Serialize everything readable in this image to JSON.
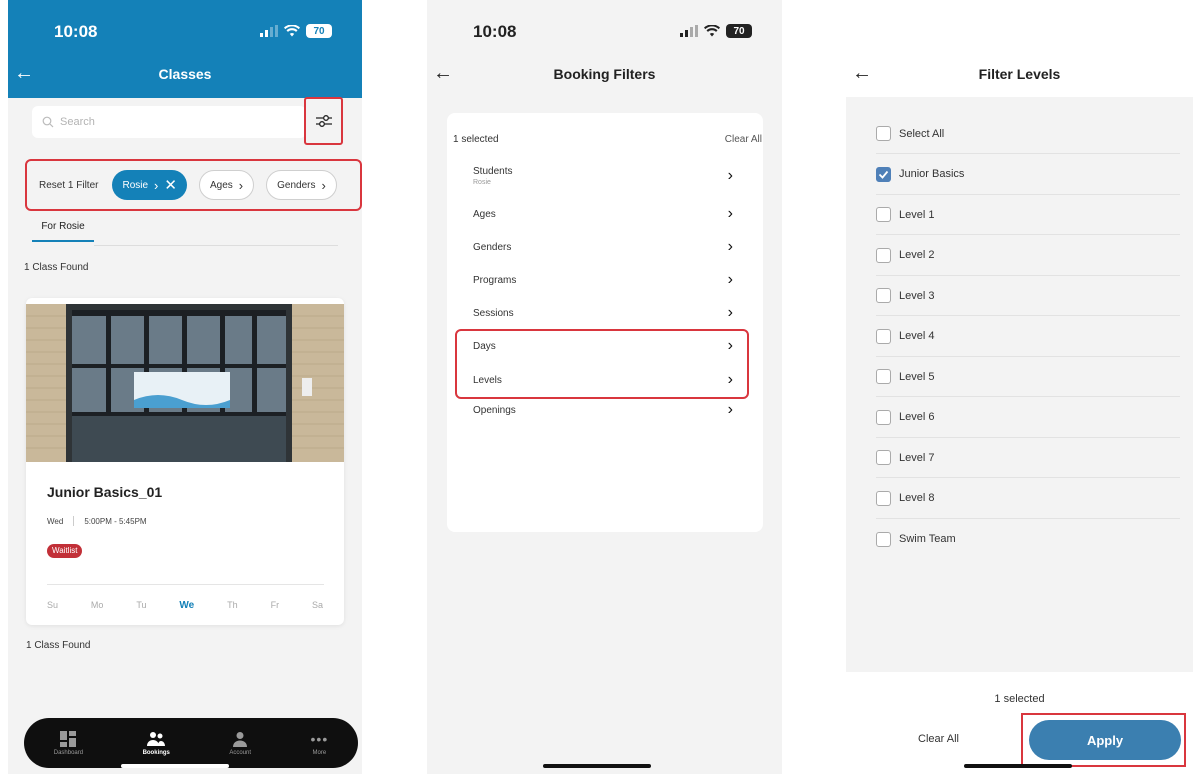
{
  "panel1": {
    "status_time": "10:08",
    "battery": "70",
    "title": "Classes",
    "search_placeholder": "Search",
    "reset_label": "Reset 1 Filter",
    "chips": [
      {
        "label": "Rosie"
      },
      {
        "label": "Ages"
      },
      {
        "label": "Genders"
      }
    ],
    "tab_label": "For Rosie",
    "found_top": "1 Class Found",
    "card": {
      "title": "Junior Basics_01",
      "day": "Wed",
      "time": "5:00PM - 5:45PM",
      "badge": "Waitlist",
      "days": [
        "Su",
        "Mo",
        "Tu",
        "We",
        "Th",
        "Fr",
        "Sa"
      ],
      "current_day": "We"
    },
    "found_bottom": "1 Class Found",
    "bottom_nav": [
      {
        "label": "Dashboard",
        "icon": "dashboard-icon"
      },
      {
        "label": "Bookings",
        "icon": "bookings-icon"
      },
      {
        "label": "Account",
        "icon": "account-icon"
      },
      {
        "label": "More",
        "icon": "more-icon"
      }
    ],
    "accent": "#1481b8"
  },
  "panel2": {
    "status_time": "10:08",
    "battery": "70",
    "title": "Booking Filters",
    "selected_count": "1 selected",
    "clear_all": "Clear All",
    "filters": [
      {
        "label": "Students",
        "sub": "Rosie"
      },
      {
        "label": "Ages"
      },
      {
        "label": "Genders"
      },
      {
        "label": "Programs"
      },
      {
        "label": "Sessions"
      },
      {
        "label": "Days"
      },
      {
        "label": "Levels"
      },
      {
        "label": "Openings"
      }
    ]
  },
  "panel3": {
    "title": "Filter Levels",
    "levels": [
      {
        "label": "Select All",
        "checked": false
      },
      {
        "label": "Junior Basics",
        "checked": true
      },
      {
        "label": "Level 1",
        "checked": false
      },
      {
        "label": "Level 2",
        "checked": false
      },
      {
        "label": "Level 3",
        "checked": false
      },
      {
        "label": "Level 4",
        "checked": false
      },
      {
        "label": "Level 5",
        "checked": false
      },
      {
        "label": "Level 6",
        "checked": false
      },
      {
        "label": "Level 7",
        "checked": false
      },
      {
        "label": "Level 8",
        "checked": false
      },
      {
        "label": "Swim Team",
        "checked": false
      }
    ],
    "selected_count": "1 selected",
    "clear_all": "Clear All",
    "apply": "Apply",
    "highlight_color": "#d9363e"
  }
}
